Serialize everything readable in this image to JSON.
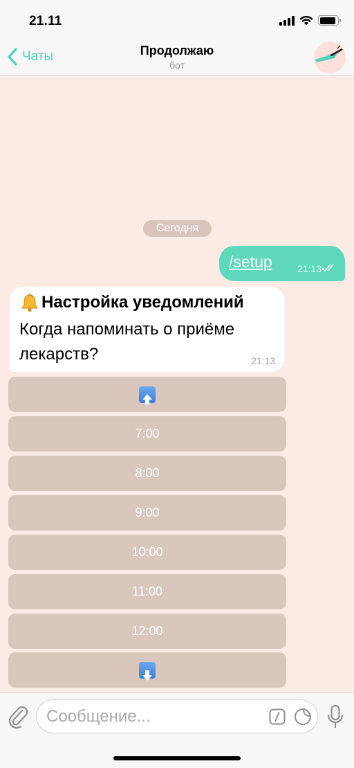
{
  "status_bar": {
    "time": "21.11",
    "icons": [
      "cellular-signal-icon",
      "wifi-icon",
      "battery-icon"
    ],
    "battery_level": 0.9
  },
  "header": {
    "back_label": "Чаты",
    "title": "Продолжаю",
    "subtitle": "бот",
    "avatar_icon": "bot-avatar-icon"
  },
  "chat": {
    "date_label": "Сегодня",
    "messages": [
      {
        "direction": "outgoing",
        "text": "/setup",
        "time": "21:13",
        "status_icon": "double-check-icon"
      },
      {
        "direction": "incoming",
        "title_icon": "bell-icon",
        "title": "Настройка уведомлений",
        "text": "Когда напоминать о приёме лекарств?",
        "time": "21:13"
      }
    ],
    "keyboard": {
      "up_icon": "arrow-up-icon",
      "buttons": [
        "7:00",
        "8:00",
        "9:00",
        "10:00",
        "11:00",
        "12:00"
      ],
      "down_icon": "arrow-down-icon"
    }
  },
  "composer": {
    "placeholder": "Сообщение...",
    "icons": [
      "paperclip-icon",
      "slash-command-icon",
      "sticker-icon",
      "microphone-icon"
    ]
  },
  "colors": {
    "accent": "#4fd4b8",
    "outgoing_bubble": "#5ed8bb",
    "chat_background": "#fcebe5",
    "keyboard_button": "#d9c6bd"
  }
}
